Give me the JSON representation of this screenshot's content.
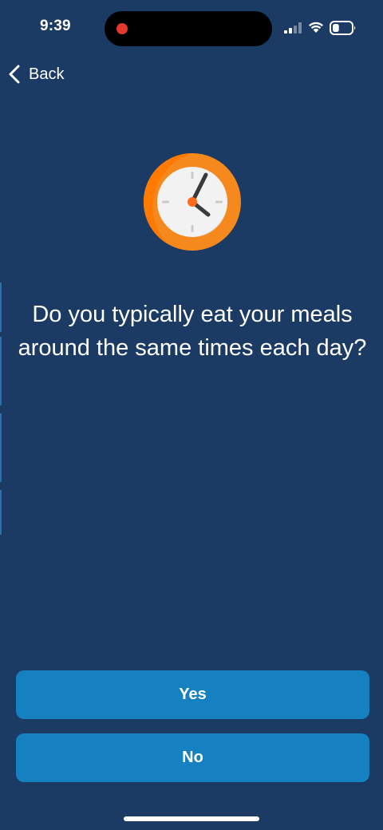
{
  "status_bar": {
    "time": "9:39",
    "recording": true,
    "battery_level": 0.35
  },
  "navigation": {
    "back_label": "Back",
    "back_icon": "chevron-left-icon"
  },
  "illustration": {
    "icon": "clock-icon",
    "colors": {
      "ring_outer": "#f5891e",
      "ring_inner": "#ff7a00",
      "face": "#f2f2f2",
      "hands": "#3a3a3a",
      "center": "#ff6a1a"
    }
  },
  "question": {
    "text": "Do you typically eat your meals around the same times each day?"
  },
  "answers": {
    "yes_label": "Yes",
    "no_label": "No"
  },
  "colors": {
    "background": "#1b3a64",
    "button": "#1581c1",
    "text": "#ffffff"
  }
}
